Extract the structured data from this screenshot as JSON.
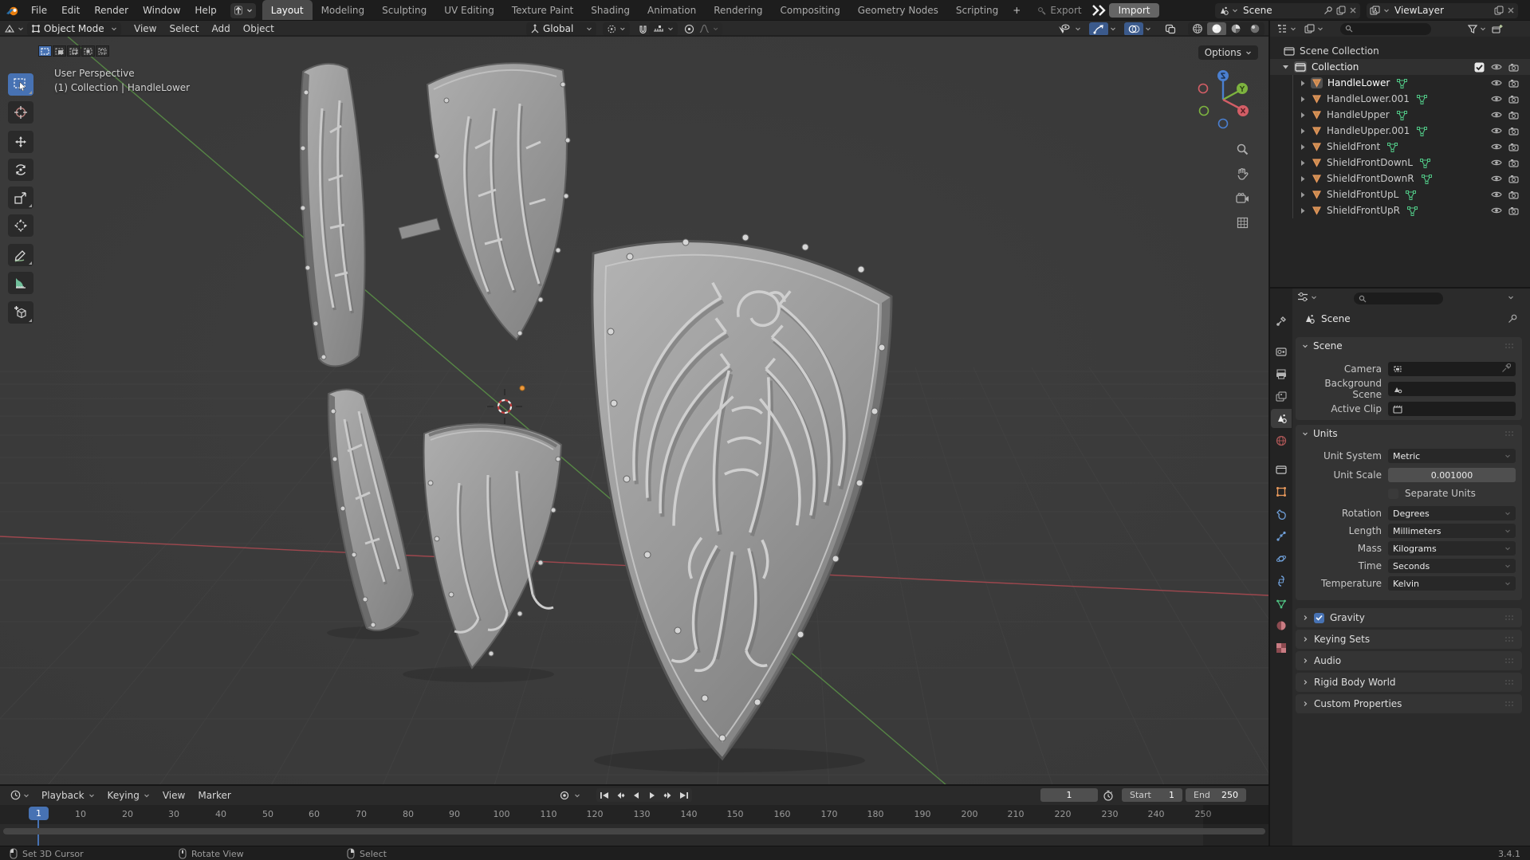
{
  "topbar": {
    "menus": [
      "File",
      "Edit",
      "Render",
      "Window",
      "Help"
    ],
    "workspaces": [
      "Layout",
      "Modeling",
      "Sculpting",
      "UV Editing",
      "Texture Paint",
      "Shading",
      "Animation",
      "Rendering",
      "Compositing",
      "Geometry Nodes",
      "Scripting"
    ],
    "add_workspace": "+",
    "export_label": "Export",
    "import_label": "Import",
    "scene_label": "Scene",
    "view_layer_label": "ViewLayer"
  },
  "viewport": {
    "header": {
      "mode": "Object Mode",
      "menus": [
        "View",
        "Select",
        "Add",
        "Object"
      ],
      "orientation": "Global",
      "options_label": "Options"
    },
    "overlay": {
      "line1": "User Perspective",
      "line2": "(1) Collection | HandleLower"
    }
  },
  "outliner": {
    "root": "Scene Collection",
    "collection": "Collection",
    "items": [
      "HandleLower",
      "HandleLower.001",
      "HandleUpper",
      "HandleUpper.001",
      "ShieldFront",
      "ShieldFrontDownL",
      "ShieldFrontDownR",
      "ShieldFrontUpL",
      "ShieldFrontUpR"
    ]
  },
  "properties": {
    "breadcrumb": "Scene",
    "scene_panel": {
      "title": "Scene",
      "camera_label": "Camera",
      "background_label": "Background Scene",
      "clip_label": "Active Clip"
    },
    "units_panel": {
      "title": "Units",
      "unit_system_label": "Unit System",
      "unit_system": "Metric",
      "unit_scale_label": "Unit Scale",
      "unit_scale": "0.001000",
      "separate_units_label": "Separate Units",
      "rotation_label": "Rotation",
      "rotation": "Degrees",
      "length_label": "Length",
      "length": "Millimeters",
      "mass_label": "Mass",
      "mass": "Kilograms",
      "time_label": "Time",
      "time": "Seconds",
      "temperature_label": "Temperature",
      "temperature": "Kelvin"
    },
    "collapsed": [
      "Gravity",
      "Keying Sets",
      "Audio",
      "Rigid Body World",
      "Custom Properties"
    ]
  },
  "timeline": {
    "menus": [
      "Playback",
      "Keying",
      "View",
      "Marker"
    ],
    "current_frame": "1",
    "start_label": "Start",
    "start_value": "1",
    "end_label": "End",
    "end_value": "250",
    "ticks": [
      "10",
      "20",
      "30",
      "40",
      "50",
      "60",
      "70",
      "80",
      "90",
      "100",
      "110",
      "120",
      "130",
      "140",
      "150",
      "160",
      "170",
      "180",
      "190",
      "200",
      "210",
      "220",
      "230",
      "240",
      "250"
    ]
  },
  "statusbar": {
    "left_click": "Set 3D Cursor",
    "middle_click": "Rotate View",
    "right_click": "Select",
    "version": "3.4.1"
  },
  "colors": {
    "accent": "#4772b3",
    "object_orange": "#e8995c",
    "mesh_green": "#4fc383",
    "axis_x": "#b04a52",
    "axis_y": "#5d9948"
  }
}
